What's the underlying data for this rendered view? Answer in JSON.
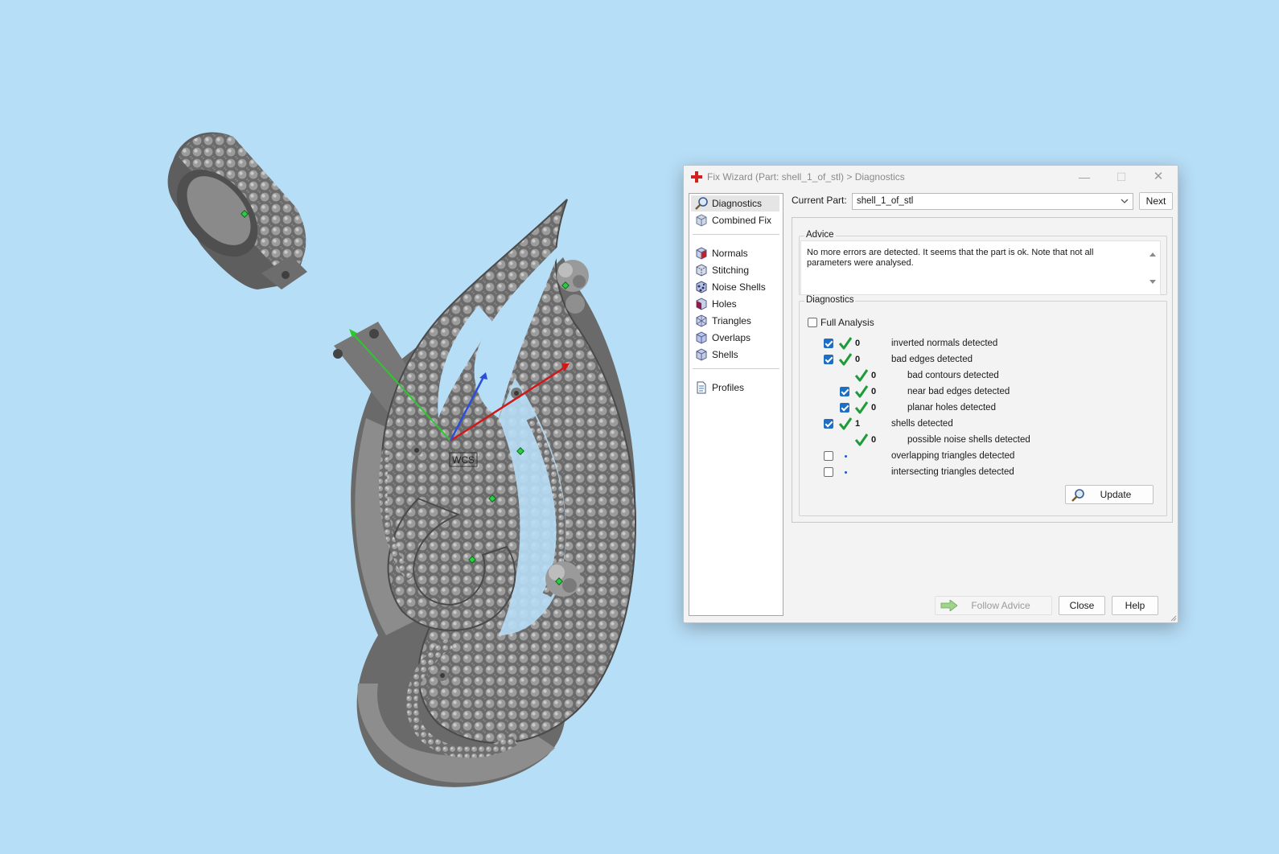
{
  "window": {
    "title": "Fix Wizard (Part: shell_1_of_stl) > Diagnostics",
    "controls": {
      "minimize": "—",
      "maximize": "☐",
      "close": "✕"
    }
  },
  "nav": {
    "items": [
      {
        "label": "Diagnostics",
        "icon": "magnifier-icon",
        "selected": true
      },
      {
        "label": "Combined Fix",
        "icon": "cube-icon"
      },
      {
        "label": "Normals",
        "icon": "normals-icon"
      },
      {
        "label": "Stitching",
        "icon": "stitching-icon"
      },
      {
        "label": "Noise Shells",
        "icon": "noise-shells-icon"
      },
      {
        "label": "Holes",
        "icon": "holes-icon"
      },
      {
        "label": "Triangles",
        "icon": "triangles-icon"
      },
      {
        "label": "Overlaps",
        "icon": "overlaps-icon"
      },
      {
        "label": "Shells",
        "icon": "shells-icon"
      },
      {
        "label": "Profiles",
        "icon": "document-icon"
      }
    ]
  },
  "current_part": {
    "label": "Current Part:",
    "value": "shell_1_of_stl",
    "next_label": "Next"
  },
  "advice": {
    "title": "Advice",
    "text": "No more errors are detected. It seems that the part is ok. Note that not all parameters were analysed."
  },
  "diagnostics": {
    "title": "Diagnostics",
    "full_analysis_label": "Full Analysis",
    "full_analysis_checked": false,
    "rows": [
      {
        "checkbox": true,
        "checked": true,
        "status": "ok",
        "count": "0",
        "label": "inverted normals detected",
        "indent": 0
      },
      {
        "checkbox": true,
        "checked": true,
        "status": "ok",
        "count": "0",
        "label": "bad edges detected",
        "indent": 0
      },
      {
        "checkbox": false,
        "checked": false,
        "status": "ok",
        "count": "0",
        "label": "bad contours detected",
        "indent": 1
      },
      {
        "checkbox": true,
        "checked": true,
        "status": "ok",
        "count": "0",
        "label": "near bad edges detected",
        "indent": 1
      },
      {
        "checkbox": true,
        "checked": true,
        "status": "ok",
        "count": "0",
        "label": "planar holes detected",
        "indent": 1
      },
      {
        "checkbox": true,
        "checked": true,
        "status": "ok",
        "count": "1",
        "label": "shells detected",
        "indent": 0
      },
      {
        "checkbox": false,
        "checked": false,
        "status": "ok",
        "count": "0",
        "label": "possible noise shells detected",
        "indent": 1
      },
      {
        "checkbox": true,
        "checked": false,
        "status": "none",
        "count": "",
        "label": "overlapping triangles detected",
        "indent": 0
      },
      {
        "checkbox": true,
        "checked": false,
        "status": "none",
        "count": "",
        "label": "intersecting triangles detected",
        "indent": 0
      }
    ],
    "update_label": "Update"
  },
  "footer": {
    "follow_advice_label": "Follow Advice",
    "close_label": "Close",
    "help_label": "Help"
  },
  "viewport": {
    "axis_label": "WCS"
  },
  "colors": {
    "background": "#b7def7",
    "model": "#7f7f7f",
    "tick": "#1e9c3a",
    "checkbox": "#1e6fc4",
    "axis_x": "#d01818",
    "axis_y": "#2cc92c",
    "axis_z": "#2b4fd8"
  }
}
